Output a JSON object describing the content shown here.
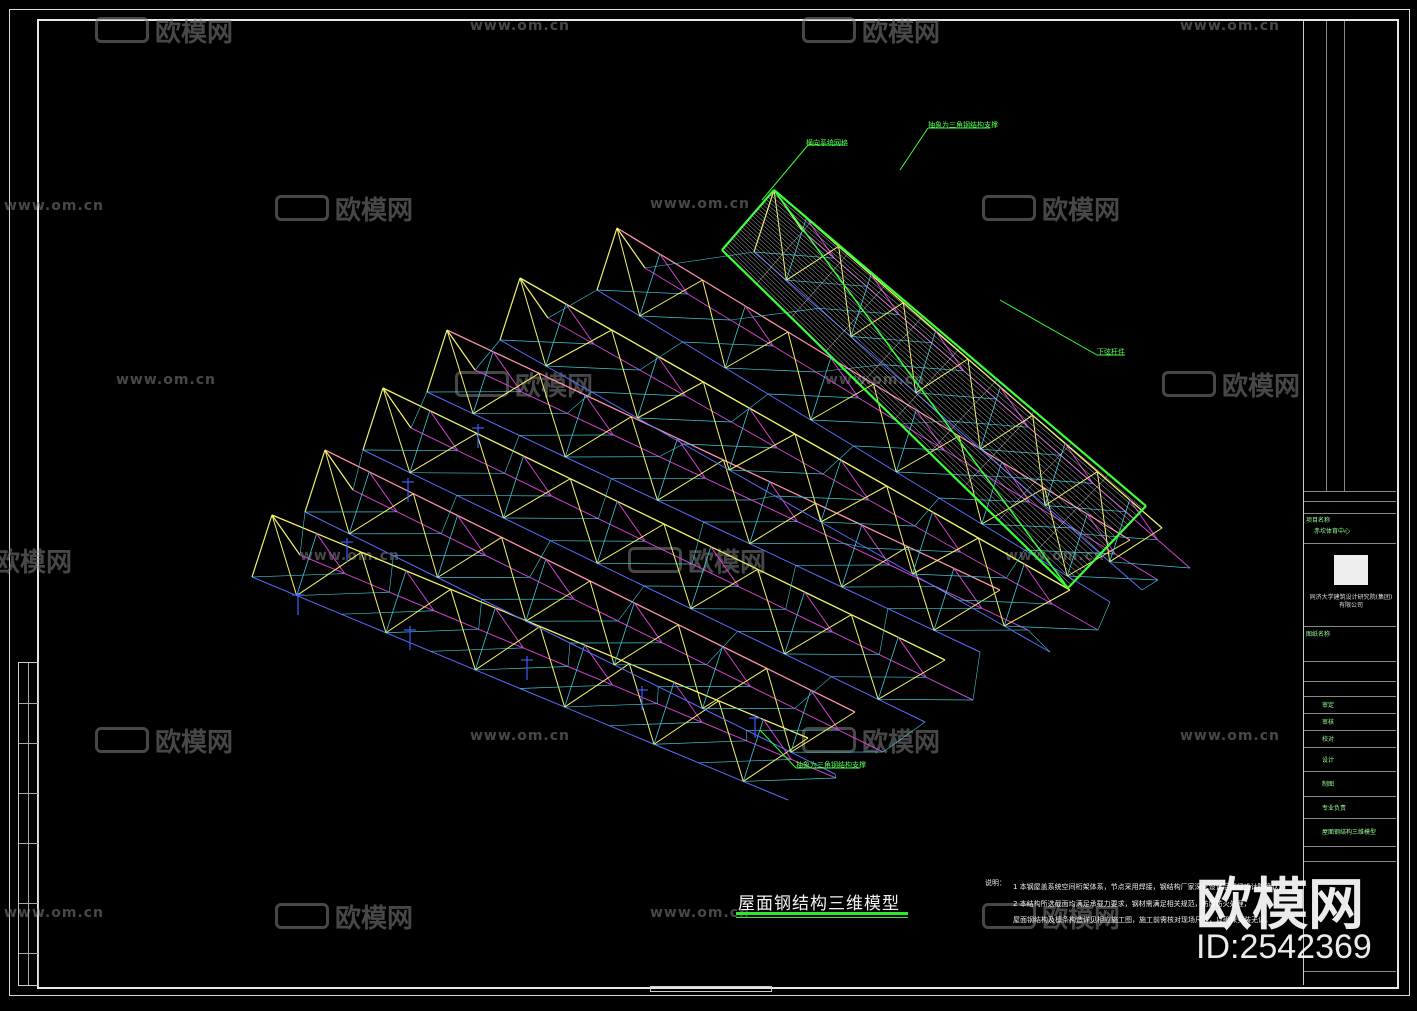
{
  "drawing": {
    "title": "屋面钢结构三维模型",
    "callouts": [
      "横向系统网格",
      "抽象为三角钢结构支撑",
      "下弦杆件",
      "抽象为三角钢结构支撑"
    ],
    "notes_label": "说明：",
    "notes": [
      "1  本钢屋盖系统空间桁架体系，节点采用焊接，钢结构厂家深化设计后须经设计院确认。",
      "2  本结构所选截面均满足承载力要求，钢材需满足相关规范，防腐防火处理，",
      "   屋面钢结构及檩条构造详见相应施工图，施工前需核对现场尺寸，以确保安装无误。"
    ]
  },
  "title_block": {
    "project_label": "项目名称",
    "project_name": "赤坎体育中心",
    "company": "同济大学建筑设计研究院(集团)有限公司",
    "drawing_label": "图纸名称",
    "drawing_name": "屋面钢结构三维模型",
    "rows": [
      "审定",
      "审核",
      "校对",
      "设计",
      "制图",
      "专业负责"
    ]
  },
  "watermarks": {
    "brand": "欧模网",
    "url": "www.om.cn"
  },
  "brand_overlay": {
    "name": "欧模网",
    "id": "ID:2542369"
  },
  "colors": {
    "background": "#000000",
    "highlight": "#39ff39",
    "yellow": "#f4f46a",
    "cyan": "#3cc8d8",
    "magenta": "#d040d0",
    "pink": "#ff8fb0",
    "blue": "#5a6cff"
  }
}
